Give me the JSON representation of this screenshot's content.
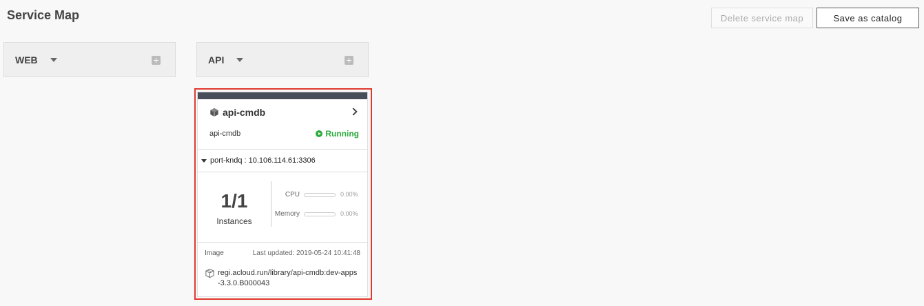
{
  "header": {
    "title": "Service Map",
    "delete_label": "Delete service map",
    "save_label": "Save as catalog"
  },
  "columns": [
    {
      "label": "WEB"
    },
    {
      "label": "API"
    }
  ],
  "card": {
    "title": "api-cmdb",
    "service_name": "api-cmdb",
    "status": "Running",
    "port": "port-kndq : 10.106.114.61:3306",
    "instances": "1/1",
    "instances_label": "Instances",
    "metrics": [
      {
        "label": "CPU",
        "value": "0.00%",
        "fraction": 0
      },
      {
        "label": "Memory",
        "value": "0.00%",
        "fraction": 0
      }
    ],
    "image_label": "Image",
    "last_updated": "Last updated: 2019-05-24 10:41:48",
    "image_path_line1": "regi.acloud.run/library/api-cmdb:dev-apps",
    "image_path_line2": "-3.3.0.B000043"
  },
  "colors": {
    "running": "#2eaa3e",
    "highlight": "#e0382c",
    "card_topbar": "#474d59"
  }
}
